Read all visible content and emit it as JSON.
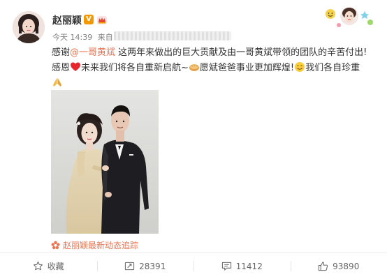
{
  "post": {
    "author": "赵丽颖",
    "verified_badge": "V",
    "time": "今天 14:39",
    "source_prefix": "来自",
    "text_line1_a": "感谢",
    "mention": "@一哥黄斌",
    "text_line1_b": " 这两年来做出的巨大贡献及由一哥黄斌带领的团队的辛苦付出!",
    "text_line2_a": "感恩",
    "text_line2_b": "未来我们将各自重新启航~",
    "text_line2_c": "愿斌爸爸事业更加辉煌!",
    "text_line2_d": "我们各自珍重",
    "link_card_label": "赵丽颖最新动态追踪"
  },
  "actions": {
    "favorite_label": "收藏",
    "repost_count": "28391",
    "comment_count": "11412",
    "like_count": "93890"
  },
  "icons": {
    "avatar": "avatar-photo",
    "crown": "crown-icon",
    "heart": "red-heart-emoji",
    "bread": "bread-emoji",
    "smile": "smile-emoji",
    "pray": "praying-hands-emoji",
    "flower": "flower-icon",
    "star": "star-icon",
    "repost": "repost-icon",
    "comment": "comment-icon",
    "like": "thumbs-up-icon"
  },
  "colors": {
    "link": "#eb7350",
    "verified": "#f39800",
    "text": "#333333",
    "meta": "#808080"
  }
}
